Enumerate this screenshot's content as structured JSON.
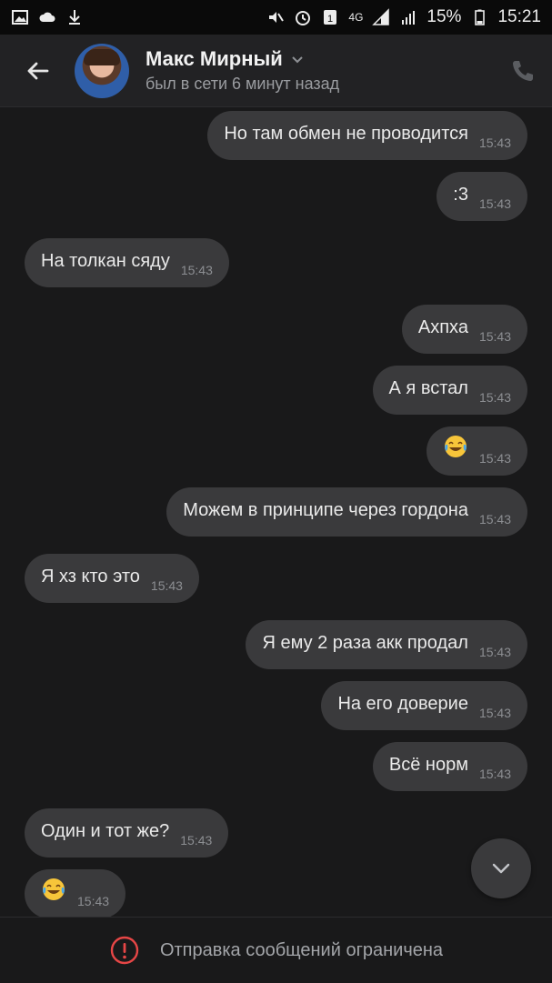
{
  "status_bar": {
    "battery": "15%",
    "time": "15:21",
    "network": "4G"
  },
  "header": {
    "name": "Макс Мирный",
    "status": "был в сети 6 минут назад"
  },
  "messages": [
    {
      "dir": "out",
      "text": "Но там обмен не проводится",
      "time": "15:43"
    },
    {
      "dir": "out",
      "text": ":3",
      "time": "15:43"
    },
    {
      "dir": "in",
      "text": "На толкан сяду",
      "time": "15:43"
    },
    {
      "dir": "out",
      "text": "Ахпха",
      "time": "15:43"
    },
    {
      "dir": "out",
      "text": "А я встал",
      "time": "15:43"
    },
    {
      "dir": "out",
      "text": "",
      "emoji": "tears-of-joy",
      "time": "15:43"
    },
    {
      "dir": "out",
      "text": "Можем в принципе через гордона",
      "time": "15:43"
    },
    {
      "dir": "in",
      "text": "Я хз кто это",
      "time": "15:43"
    },
    {
      "dir": "out",
      "text": "Я ему 2 раза акк продал",
      "time": "15:43"
    },
    {
      "dir": "out",
      "text": "На его доверие",
      "time": "15:43"
    },
    {
      "dir": "out",
      "text": "Всё норм",
      "time": "15:43"
    },
    {
      "dir": "in",
      "text": "Один и тот же?",
      "time": "15:43"
    },
    {
      "dir": "in",
      "text": "",
      "emoji": "tears-of-joy",
      "time": "15:43"
    }
  ],
  "footer": {
    "notice": "Отправка сообщений ограничена",
    "icon": "alert-circle-icon",
    "icon_color": "#e64646"
  },
  "colors": {
    "background": "#19191a",
    "bubble": "#3a3a3c",
    "header": "#222224"
  }
}
